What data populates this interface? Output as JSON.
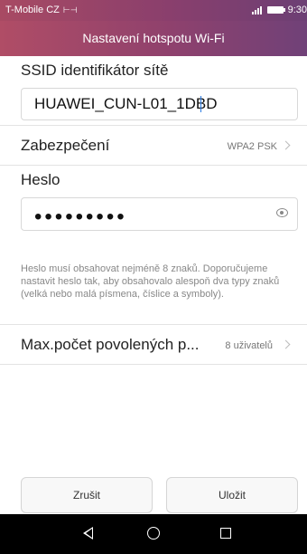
{
  "status_bar": {
    "carrier": "T-Mobile CZ",
    "carrier_icon": "dual-sim-icon",
    "time": "9:30",
    "signal_icon": "signal-icon",
    "battery_icon": "battery-icon"
  },
  "header": {
    "title": "Nastavení hotspotu Wi-Fi",
    "accent_color": "#8f416d"
  },
  "ssid": {
    "label": "SSID identifikátor sítě",
    "value": "HUAWEI_CUN-L01_1DBD"
  },
  "security": {
    "label": "Zabezpečení",
    "value": "WPA2 PSK"
  },
  "password": {
    "label": "Heslo",
    "masked_value": "•••••••••"
  },
  "helper_text": "Heslo musí obsahovat nejméně 8 znaků. Doporučujeme nastavit heslo tak, aby obsahovalo alespoň dva typy znaků (velká nebo malá písmena, číslice a symboly).",
  "max_users": {
    "label": "Max.počet povolených p...",
    "value": "8 uživatelů"
  },
  "buttons": {
    "cancel": "Zrušit",
    "save": "Uložit"
  },
  "nav_bar": {
    "back_icon": "back-triangle-icon",
    "home_icon": "home-circle-icon",
    "recent_icon": "recent-apps-square-icon"
  }
}
